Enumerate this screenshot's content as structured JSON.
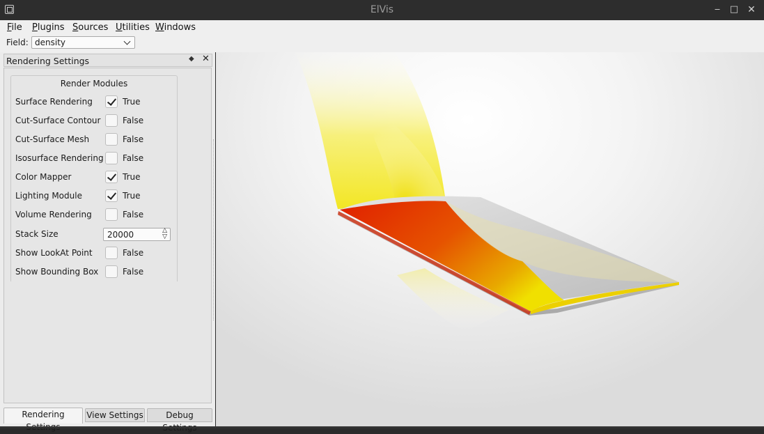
{
  "window": {
    "title": "ElVis"
  },
  "menu": {
    "items": [
      {
        "underline": "F",
        "rest": "ile"
      },
      {
        "underline": "P",
        "rest": "lugins"
      },
      {
        "underline": "S",
        "rest": "ources"
      },
      {
        "underline": "U",
        "rest": "tilities"
      },
      {
        "underline": "W",
        "rest": "indows"
      }
    ]
  },
  "fieldbar": {
    "label": "Field:",
    "selected": "density"
  },
  "dock": {
    "title": "Rendering Settings",
    "group_title": "Render Modules",
    "rows": [
      {
        "label": "Surface Rendering",
        "checked": true,
        "value": "True"
      },
      {
        "label": "Cut-Surface Contour",
        "checked": false,
        "value": "False"
      },
      {
        "label": "Cut-Surface Mesh",
        "checked": false,
        "value": "False"
      },
      {
        "label": "Isosurface Rendering",
        "checked": false,
        "value": "False"
      },
      {
        "label": "Color Mapper",
        "checked": true,
        "value": "True"
      },
      {
        "label": "Lighting Module",
        "checked": true,
        "value": "True"
      },
      {
        "label": "Volume Rendering",
        "checked": false,
        "value": "False"
      }
    ],
    "stack_size": {
      "label": "Stack Size",
      "value": "20000"
    },
    "rows2": [
      {
        "label": "Show LookAt Point",
        "checked": false,
        "value": "False"
      },
      {
        "label": "Show Bounding Box",
        "checked": false,
        "value": "False"
      }
    ],
    "tabs": [
      "Rendering Settings",
      "View Settings",
      "Debug Settings"
    ],
    "active_tab": 0
  },
  "colors": {
    "wing_gray": "#c9c9c9",
    "plume_yellow": "#ffff00",
    "hot_red": "#d81800"
  }
}
